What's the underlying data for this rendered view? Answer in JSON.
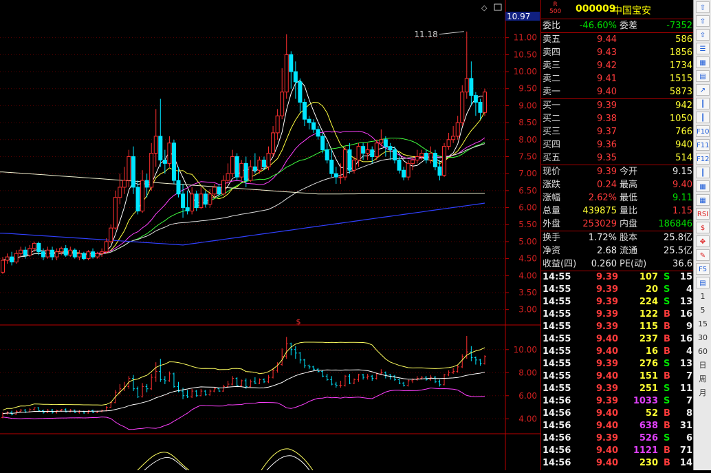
{
  "stock": {
    "r_top": "R",
    "r_bottom": "500",
    "code": "000009",
    "name": "中国宝安"
  },
  "chart_data": {
    "type": "candlestick",
    "top_marker": "11.18",
    "current_price_tag": "10.97",
    "pane_separator_glyph": "$",
    "price_axis": [
      "11.00",
      "10.50",
      "10.00",
      "9.50",
      "9.00",
      "8.50",
      "8.00",
      "7.50",
      "7.00",
      "6.50",
      "6.00",
      "5.50",
      "5.00",
      "4.50",
      "4.00",
      "3.50",
      "3.00"
    ],
    "price_range": [
      2.75,
      11.5
    ],
    "sub_axis": [
      "10.00",
      "8.00",
      "6.00",
      "4.00"
    ],
    "sub_range": [
      3.0,
      11.3
    ],
    "candles": [
      [
        4.1,
        4.45,
        4.05,
        4.55
      ],
      [
        4.45,
        4.55,
        4.35,
        4.65
      ],
      [
        4.55,
        4.4,
        4.3,
        4.7
      ],
      [
        4.4,
        4.65,
        4.35,
        4.75
      ],
      [
        4.65,
        4.75,
        4.55,
        4.85
      ],
      [
        4.75,
        4.6,
        4.5,
        4.85
      ],
      [
        4.6,
        4.8,
        4.55,
        4.9
      ],
      [
        4.8,
        4.95,
        4.7,
        5.0
      ],
      [
        4.95,
        4.7,
        4.6,
        5.0
      ],
      [
        4.7,
        4.55,
        4.45,
        4.8
      ],
      [
        4.55,
        4.75,
        4.5,
        4.85
      ],
      [
        4.75,
        4.55,
        4.45,
        4.85
      ],
      [
        4.55,
        4.7,
        4.45,
        4.8
      ],
      [
        4.7,
        4.8,
        4.6,
        4.85
      ],
      [
        4.8,
        4.6,
        4.55,
        4.9
      ],
      [
        4.6,
        4.75,
        4.55,
        4.85
      ],
      [
        4.75,
        4.55,
        4.5,
        4.8
      ],
      [
        4.55,
        4.65,
        4.45,
        4.75
      ],
      [
        4.65,
        4.5,
        4.45,
        4.7
      ],
      [
        4.5,
        4.7,
        4.45,
        4.75
      ],
      [
        4.7,
        4.55,
        4.5,
        4.8
      ],
      [
        4.55,
        4.65,
        4.5,
        4.7
      ],
      [
        4.65,
        4.7,
        4.55,
        4.8
      ],
      [
        4.7,
        5.0,
        4.65,
        5.1
      ],
      [
        5.0,
        5.4,
        4.95,
        5.5
      ],
      [
        5.4,
        6.3,
        5.35,
        6.5
      ],
      [
        6.3,
        6.6,
        6.1,
        7.0
      ],
      [
        6.6,
        6.8,
        6.4,
        7.2
      ],
      [
        6.8,
        7.5,
        6.6,
        7.7
      ],
      [
        7.5,
        6.6,
        6.4,
        7.8
      ],
      [
        6.6,
        5.9,
        5.8,
        6.8
      ],
      [
        5.9,
        6.8,
        5.85,
        7.1
      ],
      [
        6.8,
        6.6,
        6.3,
        7.0
      ],
      [
        6.6,
        7.6,
        6.5,
        7.9
      ],
      [
        7.6,
        8.1,
        7.2,
        8.9
      ],
      [
        8.1,
        7.4,
        7.2,
        9.2
      ],
      [
        7.4,
        7.3,
        7.0,
        7.7
      ],
      [
        7.3,
        7.9,
        7.2,
        8.1
      ],
      [
        7.9,
        6.8,
        6.7,
        8.0
      ],
      [
        6.8,
        6.4,
        6.3,
        7.2
      ],
      [
        6.4,
        6.0,
        5.7,
        6.7
      ],
      [
        6.0,
        5.9,
        5.8,
        6.5
      ],
      [
        5.9,
        6.4,
        5.8,
        6.6
      ],
      [
        6.4,
        6.0,
        5.9,
        6.5
      ],
      [
        6.0,
        6.4,
        5.95,
        6.6
      ],
      [
        6.4,
        6.1,
        6.0,
        6.5
      ],
      [
        6.1,
        6.4,
        6.0,
        6.55
      ],
      [
        6.4,
        6.6,
        6.3,
        6.7
      ],
      [
        6.6,
        6.4,
        6.35,
        6.7
      ],
      [
        6.4,
        6.8,
        6.35,
        6.95
      ],
      [
        6.8,
        7.0,
        6.7,
        7.3
      ],
      [
        7.0,
        7.5,
        6.9,
        7.7
      ],
      [
        7.5,
        6.9,
        6.8,
        7.6
      ],
      [
        6.9,
        7.3,
        6.8,
        7.4
      ],
      [
        7.3,
        6.8,
        6.6,
        7.5
      ],
      [
        6.8,
        7.2,
        6.75,
        7.4
      ],
      [
        7.2,
        7.1,
        7.0,
        7.6
      ],
      [
        7.1,
        7.4,
        7.0,
        7.5
      ],
      [
        7.4,
        7.2,
        7.1,
        7.5
      ],
      [
        7.2,
        7.6,
        7.1,
        7.8
      ],
      [
        7.6,
        8.2,
        7.5,
        8.4
      ],
      [
        8.2,
        8.7,
        8.0,
        8.9
      ],
      [
        8.7,
        9.4,
        8.6,
        10.1
      ],
      [
        9.4,
        10.5,
        9.2,
        11.1
      ],
      [
        10.5,
        10.0,
        9.5,
        10.6
      ],
      [
        10.0,
        9.7,
        9.2,
        10.3
      ],
      [
        9.7,
        9.1,
        8.8,
        9.8
      ],
      [
        9.1,
        8.6,
        8.4,
        9.2
      ],
      [
        8.6,
        8.5,
        8.3,
        8.7
      ],
      [
        8.5,
        8.3,
        8.2,
        8.6
      ],
      [
        8.3,
        8.1,
        8.0,
        8.4
      ],
      [
        8.1,
        7.7,
        7.6,
        8.2
      ],
      [
        7.7,
        7.4,
        7.3,
        7.9
      ],
      [
        7.4,
        7.0,
        6.9,
        7.7
      ],
      [
        7.0,
        6.9,
        6.7,
        7.2
      ],
      [
        6.9,
        6.9,
        6.7,
        7.3
      ],
      [
        6.9,
        7.7,
        6.8,
        7.8
      ],
      [
        7.7,
        7.1,
        7.0,
        7.9
      ],
      [
        7.1,
        7.4,
        7.0,
        7.5
      ],
      [
        7.4,
        7.8,
        7.2,
        7.9
      ],
      [
        7.8,
        7.6,
        7.4,
        7.9
      ],
      [
        7.6,
        7.7,
        7.4,
        7.9
      ],
      [
        7.7,
        7.5,
        7.3,
        7.8
      ],
      [
        7.5,
        7.9,
        7.4,
        8.0
      ],
      [
        7.9,
        8.0,
        7.8,
        8.3
      ],
      [
        8.0,
        7.8,
        7.5,
        8.1
      ],
      [
        7.8,
        7.7,
        7.4,
        7.9
      ],
      [
        7.7,
        7.4,
        7.3,
        7.8
      ],
      [
        7.4,
        7.1,
        7.0,
        7.5
      ],
      [
        7.1,
        6.9,
        6.8,
        7.2
      ],
      [
        6.9,
        7.3,
        6.8,
        7.4
      ],
      [
        7.3,
        7.4,
        7.1,
        7.5
      ],
      [
        7.4,
        7.5,
        7.3,
        7.7
      ],
      [
        7.5,
        7.6,
        7.4,
        7.7
      ],
      [
        7.6,
        7.4,
        7.3,
        7.7
      ],
      [
        7.4,
        7.6,
        7.3,
        7.8
      ],
      [
        7.6,
        7.2,
        7.1,
        7.7
      ],
      [
        7.2,
        6.95,
        6.8,
        7.4
      ],
      [
        6.95,
        7.8,
        6.9,
        7.9
      ],
      [
        7.8,
        8.0,
        7.7,
        8.2
      ],
      [
        8.0,
        8.1,
        7.9,
        8.4
      ],
      [
        8.1,
        8.5,
        8.0,
        8.7
      ],
      [
        8.5,
        9.4,
        8.4,
        9.6
      ],
      [
        9.4,
        9.8,
        9.2,
        11.18
      ],
      [
        9.8,
        9.3,
        9.0,
        10.3
      ],
      [
        9.3,
        9.1,
        8.7,
        9.4
      ],
      [
        9.1,
        8.8,
        8.6,
        9.2
      ],
      [
        8.8,
        9.4,
        8.7,
        9.5
      ]
    ]
  },
  "quote": {
    "weibi_label": "委比",
    "weibi_value": "-46.60%",
    "weicha_label": "委差",
    "weicha_value": "-7352",
    "asks": [
      {
        "label": "卖五",
        "price": "9.44",
        "vol": "586"
      },
      {
        "label": "卖四",
        "price": "9.43",
        "vol": "1856"
      },
      {
        "label": "卖三",
        "price": "9.42",
        "vol": "1734"
      },
      {
        "label": "卖二",
        "price": "9.41",
        "vol": "1515"
      },
      {
        "label": "卖一",
        "price": "9.40",
        "vol": "5873"
      }
    ],
    "bids": [
      {
        "label": "买一",
        "price": "9.39",
        "vol": "942"
      },
      {
        "label": "买二",
        "price": "9.38",
        "vol": "1050"
      },
      {
        "label": "买三",
        "price": "9.37",
        "vol": "766"
      },
      {
        "label": "买四",
        "price": "9.36",
        "vol": "940"
      },
      {
        "label": "买五",
        "price": "9.35",
        "vol": "514"
      }
    ],
    "stats": [
      {
        "l1": "现价",
        "v1": "9.39",
        "c1": "red",
        "l2": "今开",
        "v2": "9.15",
        "c2": "wht"
      },
      {
        "l1": "涨跌",
        "v1": "0.24",
        "c1": "red",
        "l2": "最高",
        "v2": "9.40",
        "c2": "red"
      },
      {
        "l1": "涨幅",
        "v1": "2.62%",
        "c1": "red",
        "l2": "最低",
        "v2": "9.11",
        "c2": "grn"
      },
      {
        "l1": "总量",
        "v1": "439875",
        "c1": "yel",
        "l2": "量比",
        "v2": "1.15",
        "c2": "red"
      },
      {
        "l1": "外盘",
        "v1": "253029",
        "c1": "red",
        "l2": "内盘",
        "v2": "186846",
        "c2": "grn"
      }
    ],
    "fin": [
      {
        "l1": "换手",
        "v1": "1.72%",
        "l2": "股本",
        "v2": "25.8亿"
      },
      {
        "l1": "净资",
        "v1": "2.68",
        "l2": "流通",
        "v2": "25.5亿"
      },
      {
        "l1": "收益(四)",
        "v1": "0.260",
        "l2": "PE(动)",
        "v2": "36.6"
      }
    ],
    "ticks": [
      {
        "t": "14:55",
        "p": "9.39",
        "v": "107",
        "bs": "S",
        "n": "15"
      },
      {
        "t": "14:55",
        "p": "9.39",
        "v": "20",
        "bs": "S",
        "n": "4"
      },
      {
        "t": "14:55",
        "p": "9.39",
        "v": "224",
        "bs": "S",
        "n": "13"
      },
      {
        "t": "14:55",
        "p": "9.39",
        "v": "122",
        "bs": "B",
        "n": "16"
      },
      {
        "t": "14:55",
        "p": "9.39",
        "v": "115",
        "bs": "B",
        "n": "9"
      },
      {
        "t": "14:55",
        "p": "9.40",
        "v": "237",
        "bs": "B",
        "n": "16"
      },
      {
        "t": "14:55",
        "p": "9.40",
        "v": "16",
        "bs": "B",
        "n": "4"
      },
      {
        "t": "14:55",
        "p": "9.39",
        "v": "276",
        "bs": "S",
        "n": "13"
      },
      {
        "t": "14:55",
        "p": "9.40",
        "v": "151",
        "bs": "B",
        "n": "7"
      },
      {
        "t": "14:55",
        "p": "9.39",
        "v": "251",
        "bs": "S",
        "n": "11"
      },
      {
        "t": "14:56",
        "p": "9.39",
        "v": "1033",
        "bs": "S",
        "n": "7"
      },
      {
        "t": "14:56",
        "p": "9.40",
        "v": "52",
        "bs": "B",
        "n": "8"
      },
      {
        "t": "14:56",
        "p": "9.40",
        "v": "638",
        "bs": "B",
        "n": "31"
      },
      {
        "t": "14:56",
        "p": "9.39",
        "v": "526",
        "bs": "S",
        "n": "6"
      },
      {
        "t": "14:56",
        "p": "9.40",
        "v": "1121",
        "bs": "B",
        "n": "71"
      },
      {
        "t": "14:56",
        "p": "9.40",
        "v": "230",
        "bs": "B",
        "n": "14"
      }
    ]
  },
  "toolbar": {
    "icons": [
      "arrow-up-icon",
      "arrow-up-icon",
      "arrow-up-icon",
      "list-icon",
      "chart-icon",
      "grid-icon",
      "trend-icon",
      "kline-icon",
      "kline-icon",
      "kline-icon",
      "chart-icon",
      "chart-icon",
      "chart-icon",
      "chart-icon",
      "chart-icon",
      "chart-icon",
      "chart-icon",
      "wave-icon"
    ],
    "labels": {
      "f10": "F10",
      "f11": "F11",
      "f12": "F12",
      "rsi": "RSI",
      "f5": "F5",
      "n1": "1",
      "n5": "5",
      "n15": "15",
      "n30": "30",
      "n60": "60",
      "day": "日",
      "week": "周",
      "month": "月"
    }
  }
}
